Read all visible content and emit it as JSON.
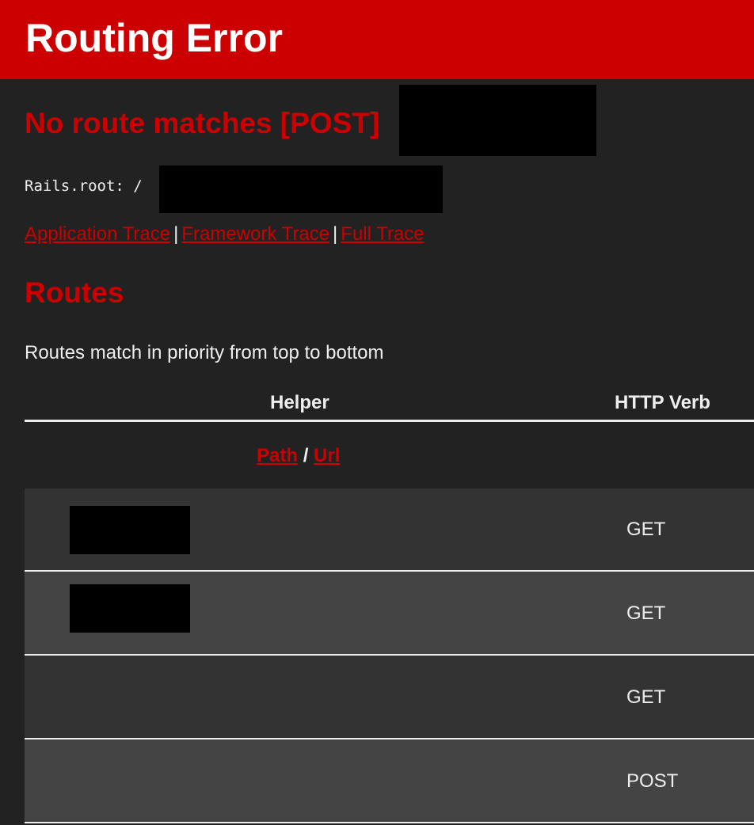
{
  "header": {
    "title": "Routing Error"
  },
  "error": {
    "message": "No route matches [POST]"
  },
  "rails_root": {
    "label": "Rails.root: /"
  },
  "traces": {
    "application": "Application Trace",
    "framework": "Framework Trace",
    "full": "Full Trace",
    "separator": "|"
  },
  "routes": {
    "heading": "Routes",
    "description": "Routes match in priority from top to bottom",
    "columns": {
      "helper": "Helper",
      "verb": "HTTP Verb"
    },
    "path_label": "Path",
    "path_url_separator": "/",
    "url_label": "Url",
    "rows": [
      {
        "verb": "GET"
      },
      {
        "verb": "GET"
      },
      {
        "verb": "GET"
      },
      {
        "verb": "POST"
      }
    ]
  },
  "colors": {
    "accent": "#cc0000",
    "background": "#222222",
    "row_dark": "#333333",
    "row_light": "#444444",
    "text": "#eeeeee"
  }
}
